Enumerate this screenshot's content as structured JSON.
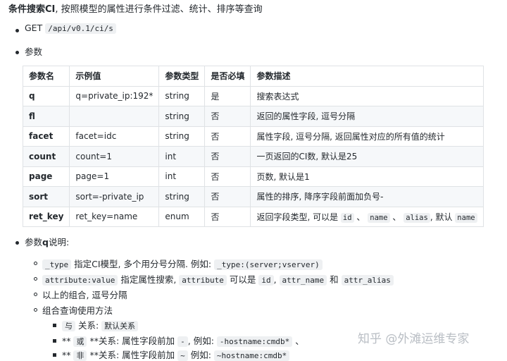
{
  "heading": {
    "bold": "条件搜索CI",
    "rest": ", 按照模型的属性进行条件过滤、统计、排序等查询"
  },
  "endpoint": {
    "method": "GET",
    "path": "/api/v0.1/ci/s"
  },
  "params_label": "参数",
  "table": {
    "headers": [
      "参数名",
      "示例值",
      "参数类型",
      "是否必填",
      "参数描述"
    ],
    "rows": [
      {
        "name": "q",
        "example": "q=private_ip:192*",
        "type": "string",
        "required": "是",
        "desc": "搜索表达式"
      },
      {
        "name": "fl",
        "example": "",
        "type": "string",
        "required": "否",
        "desc": "返回的属性字段, 逗号分隔"
      },
      {
        "name": "facet",
        "example": "facet=idc",
        "type": "string",
        "required": "否",
        "desc": "属性字段, 逗号分隔, 返回属性对应的所有值的统计"
      },
      {
        "name": "count",
        "example": "count=1",
        "type": "int",
        "required": "否",
        "desc": "一页返回的CI数, 默认是25"
      },
      {
        "name": "page",
        "example": "page=1",
        "type": "int",
        "required": "否",
        "desc": "页数, 默认是1"
      },
      {
        "name": "sort",
        "example": "sort=-private_ip",
        "type": "string",
        "required": "否",
        "desc": "属性的排序, 降序字段前面加负号-"
      },
      {
        "name": "ret_key",
        "example": "ret_key=name",
        "type": "enum",
        "required": "否",
        "desc": "返回字段类型, 可以是"
      }
    ],
    "ret_key_codes": {
      "id": "id",
      "name": "name",
      "alias": "alias",
      "sep": "、",
      "default_text": ", 默认",
      "default_code": "name"
    }
  },
  "q_section": {
    "title_prefix": "参数",
    "title_bold": "q",
    "title_suffix": "说明:",
    "items": [
      {
        "code1": "_type",
        "text1": " 指定CI模型, 多个用分号分隔. 例如: ",
        "code2": "_type:(server;vserver)"
      },
      {
        "code1": "attribute:value",
        "text1": " 指定属性搜索, ",
        "code2": "attribute",
        "text2": " 可以是 ",
        "code3": "id",
        "text3": ", ",
        "code4": "attr_name",
        "text4": " 和 ",
        "code5": "attr_alias"
      },
      {
        "text": "以上的组合, 逗号分隔"
      },
      {
        "text": "组合查询使用方法"
      }
    ],
    "sub_items": [
      {
        "code_a": "与",
        "text_a": " 关系: ",
        "code_b": "默认关系"
      },
      {
        "prefix": "** ",
        "code_a": "或",
        "text_a": " **关系: 属性字段前加 ",
        "code_b": "-",
        "text_b": ", 例如: ",
        "code_c": "-hostname:cmdb*",
        "text_c": " 、"
      },
      {
        "prefix": "** ",
        "code_a": "非",
        "text_a": " **关系: 属性字段前加 ",
        "code_b": "~",
        "text_b": " 例如: ",
        "code_c": "~hostname:cmdb*"
      }
    ]
  },
  "watermark": "知乎 @外滩运维专家"
}
